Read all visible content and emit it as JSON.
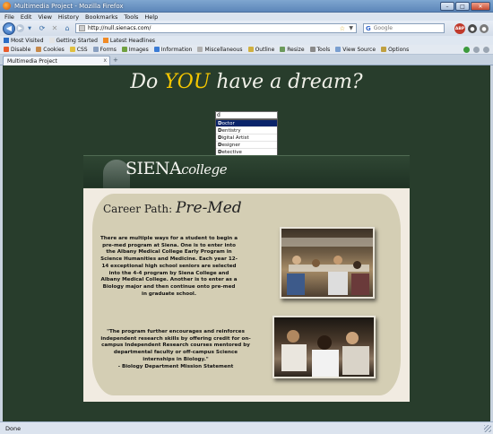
{
  "window": {
    "title": "Multimedia Project - Mozilla Firefox",
    "min": "–",
    "max": "□",
    "close": "✕"
  },
  "menu": [
    "File",
    "Edit",
    "View",
    "History",
    "Bookmarks",
    "Tools",
    "Help"
  ],
  "nav": {
    "url": "http://null.sienacs.com/",
    "search_placeholder": "Google",
    "search_engine_glyph": "G",
    "adblock_label": "ABP"
  },
  "bookmarks": [
    {
      "label": "Most Visited",
      "color": "#2b6cc4"
    },
    {
      "label": "Getting Started",
      "color": "#e4e4e4"
    },
    {
      "label": "Latest Headlines",
      "color": "#f08a24"
    }
  ],
  "devbar": [
    {
      "label": "Disable",
      "color": "#e85c2c"
    },
    {
      "label": "Cookies",
      "color": "#c6894a"
    },
    {
      "label": "CSS",
      "color": "#e0c040"
    },
    {
      "label": "Forms",
      "color": "#8aa0c0"
    },
    {
      "label": "Images",
      "color": "#70a040"
    },
    {
      "label": "Information",
      "color": "#3a7bd5"
    },
    {
      "label": "Miscellaneous",
      "color": "#b0b0b0"
    },
    {
      "label": "Outline",
      "color": "#d0b040"
    },
    {
      "label": "Resize",
      "color": "#6c9a5c"
    },
    {
      "label": "Tools",
      "color": "#8a8a8a"
    },
    {
      "label": "View Source",
      "color": "#7a9fd0"
    },
    {
      "label": "Options",
      "color": "#c0a040"
    }
  ],
  "tab": {
    "label": "Multimedia Project",
    "close": "x",
    "new": "+"
  },
  "page": {
    "headline_pre": "Do",
    "headline_you": "YOU",
    "headline_post": "have a dream?",
    "input_value": "d",
    "suggestions": [
      {
        "first": "D",
        "rest": "octor"
      },
      {
        "first": "D",
        "rest": "entistry"
      },
      {
        "first": "D",
        "rest": "igital Artist"
      },
      {
        "first": "D",
        "rest": "esigner"
      },
      {
        "first": "D",
        "rest": "etective"
      }
    ],
    "logo_main": "SIENA",
    "logo_sub": "college",
    "career_label": "Career Path:",
    "career_name": "Pre-Med",
    "para1": "There are multiple ways for a student to begin a pre-med program at Siena.  One is to enter into the Albany Medical College Early Program in Science Humanities and Medicine.  Each year 12-14 exceptional high school seniors are selected into the 4-4 program by Siena College and Albany Medical College.  Another is to enter as a Biology major and then continue onto pre-med in graduate school.",
    "quote": "\"The program further encourages and reinforces independent research skills by offering credit for on-campus Independent Research courses mentored by departmental faculty or off-campus Science internships in Biology.\"",
    "quote_source": "- Biology Department Mission Statement"
  },
  "status": {
    "text": "Done"
  },
  "colors": {
    "page_bg": "#283d2c",
    "accent_you": "#f6c700",
    "card": "#d4ceb4",
    "suggestion_selected": "#0a246a"
  }
}
